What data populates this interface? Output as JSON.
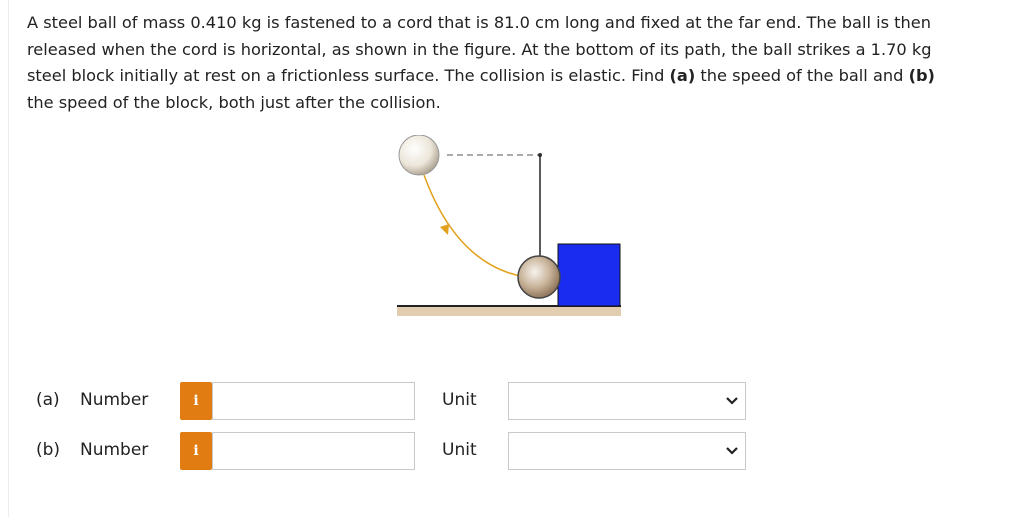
{
  "question": {
    "line1": "A steel ball of mass 0.410 kg is fastened to a cord that is 81.0 cm long and fixed at the far end. The ball is then",
    "line2": "released when the cord is horizontal, as shown in the figure. At the bottom of its path, the ball strikes a 1.70 kg",
    "line3_start": "steel block initially at rest on a frictionless surface. The collision is elastic. Find ",
    "part_a_tag": "(a)",
    "line3_mid": " the speed of the ball and ",
    "part_b_tag": "(b)",
    "line4": "the speed of the block, both just after the collision."
  },
  "figure": {
    "colors": {
      "ball_fill": "#c9b49a",
      "ball_released_fill": "#ece6da",
      "block": "#1a2cf0",
      "surface": "#e3cdb0",
      "arc": "#e2a01c",
      "cord": "#222222"
    }
  },
  "answers": [
    {
      "part": "(a)",
      "number_label": "Number",
      "info_glyph": "i",
      "number_value": "",
      "unit_label": "Unit",
      "unit_value": ""
    },
    {
      "part": "(b)",
      "number_label": "Number",
      "info_glyph": "i",
      "number_value": "",
      "unit_label": "Unit",
      "unit_value": ""
    }
  ],
  "icons": {
    "info": "info-icon",
    "dropdown": "chevron-down-icon"
  },
  "accent_colors": {
    "info_button": "#e07c12",
    "input_border": "#c9c9c9"
  }
}
